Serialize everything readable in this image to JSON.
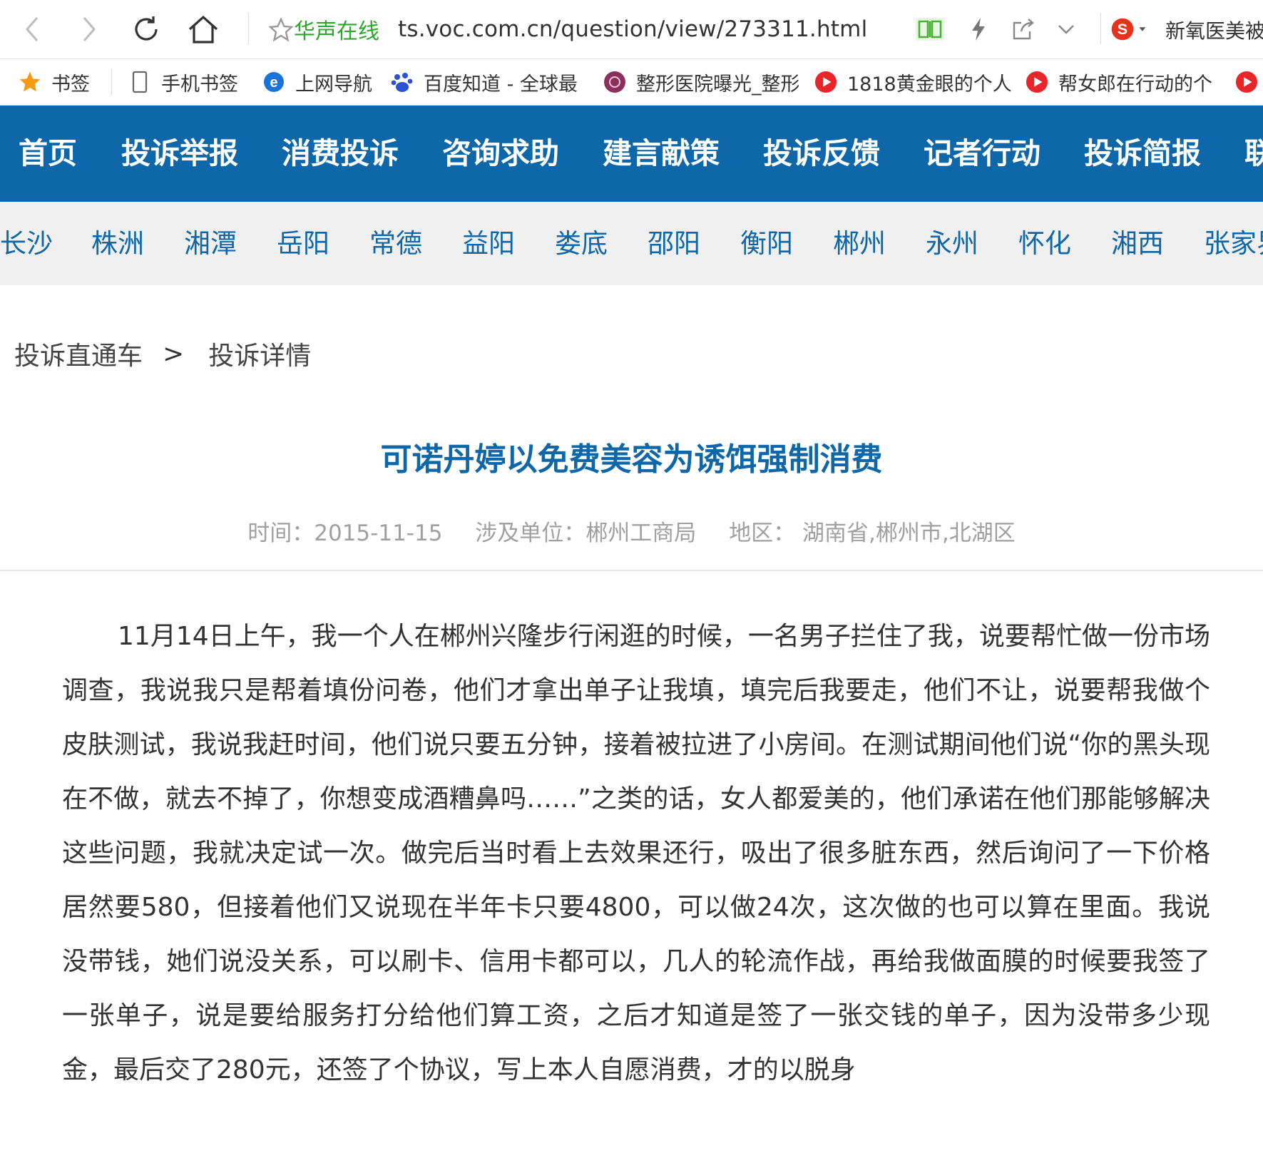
{
  "browser": {
    "site_name": "华声在线",
    "url": "ts.voc.com.cn/question/view/273311.html",
    "extension_text": "新氧医美被"
  },
  "bookmarks": [
    {
      "label": "书签",
      "icon": "star-icon"
    },
    {
      "label": "手机书签",
      "icon": "phone-icon"
    },
    {
      "label": "上网导航",
      "icon": "ie-icon"
    },
    {
      "label": "百度知道 - 全球最",
      "icon": "baidu-icon"
    },
    {
      "label": "整形医院曝光_整形",
      "icon": "clinic-logo-icon"
    },
    {
      "label": "1818黄金眼的个人",
      "icon": "video-icon"
    },
    {
      "label": "帮女郎在行动的个",
      "icon": "video-icon"
    }
  ],
  "colors": {
    "nav_blue": "#0d67a8",
    "title_blue": "#0d67a8",
    "site_green": "#2aa82a"
  },
  "main_nav": [
    "首页",
    "投诉举报",
    "消费投诉",
    "咨询求助",
    "建言献策",
    "投诉反馈",
    "记者行动",
    "投诉简报",
    "联"
  ],
  "sub_nav": [
    "长沙",
    "株洲",
    "湘潭",
    "岳阳",
    "常德",
    "益阳",
    "娄底",
    "邵阳",
    "衡阳",
    "郴州",
    "永州",
    "怀化",
    "湘西",
    "张家界"
  ],
  "breadcrumb": {
    "root": "投诉直通车",
    "separator": ">",
    "current": "投诉详情"
  },
  "article": {
    "title": "可诺丹婷以免费美容为诱饵强制消费",
    "time": "时间：2015-11-15",
    "unit": "涉及单位：郴州工商局",
    "region": "地区： 湖南省,郴州市,北湖区",
    "body": "11月14日上午，我一个人在郴州兴隆步行闲逛的时候，一名男子拦住了我，说要帮忙做一份市场调查，我说我只是帮着填份问卷，他们才拿出单子让我填，填完后我要走，他们不让，说要帮我做个皮肤测试，我说我赶时间，他们说只要五分钟，接着被拉进了小房间。在测试期间他们说“你的黑头现在不做，就去不掉了，你想变成酒糟鼻吗……”之类的话，女人都爱美的，他们承诺在他们那能够解决这些问题，我就决定试一次。做完后当时看上去效果还行，吸出了很多脏东西，然后询问了一下价格居然要580，但接着他们又说现在半年卡只要4800，可以做24次，这次做的也可以算在里面。我说没带钱，她们说没关系，可以刷卡、信用卡都可以，几人的轮流作战，再给我做面膜的时候要我签了一张单子，说是要给服务打分给他们算工资，之后才知道是签了一张交钱的单子，因为没带多少现金，最后交了280元，还签了个协议，写上本人自愿消费，才的以脱身"
  }
}
